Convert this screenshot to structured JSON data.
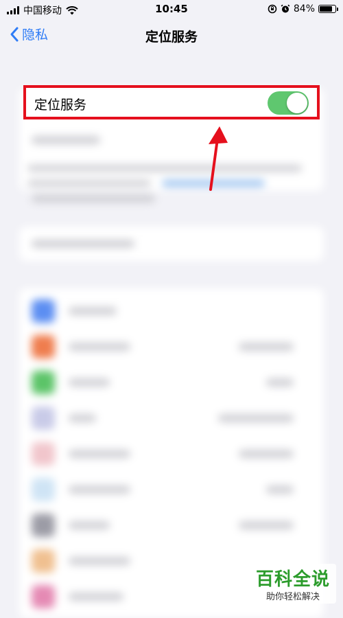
{
  "status_bar": {
    "carrier": "中国移动",
    "time": "10:45",
    "battery": "84%",
    "battery_level": 0.84,
    "icons": [
      "signal-icon",
      "wifi-icon",
      "rotation-lock-icon",
      "alarm-icon",
      "battery-icon"
    ]
  },
  "nav": {
    "back_label": "隐私",
    "title": "定位服务"
  },
  "location_services": {
    "label": "定位服务",
    "toggle_on": true
  },
  "watermark": {
    "title": "百科全说",
    "subtitle": "助你轻松解决"
  },
  "colors": {
    "accent": "#2f7cf6",
    "toggle_on": "#5fc76f",
    "highlight": "#e5101d",
    "background": "#f2f2f7"
  }
}
